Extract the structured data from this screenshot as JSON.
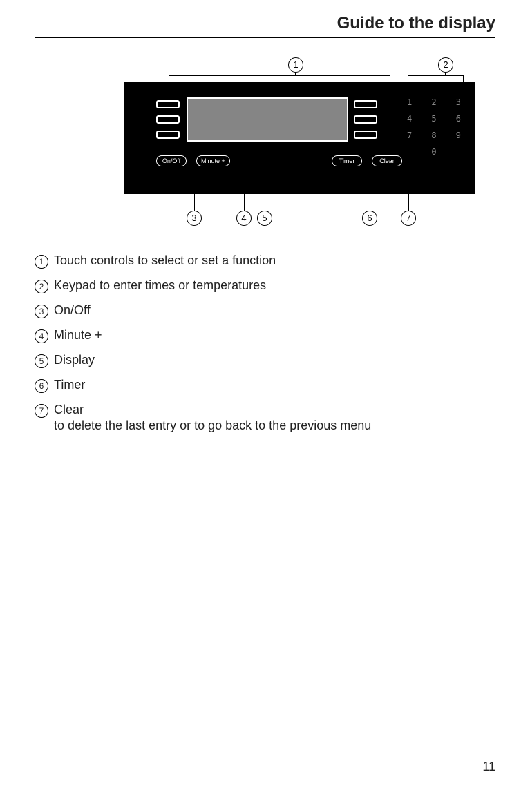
{
  "page": {
    "title": "Guide to the display",
    "number": "11"
  },
  "panel": {
    "buttons": {
      "onoff": "On/Off",
      "minute": "Minute +",
      "timer": "Timer",
      "clear": "Clear"
    },
    "keypad": [
      "1",
      "2",
      "3",
      "4",
      "5",
      "6",
      "7",
      "8",
      "9",
      "0"
    ]
  },
  "callouts": {
    "c1": "1",
    "c2": "2",
    "c3": "3",
    "c4": "4",
    "c5": "5",
    "c6": "6",
    "c7": "7"
  },
  "legend": [
    {
      "num": "1",
      "text": "Touch controls to select or set a function"
    },
    {
      "num": "2",
      "text": "Keypad to enter times or temperatures"
    },
    {
      "num": "3",
      "text": "On/Off"
    },
    {
      "num": "4",
      "text": "Minute +"
    },
    {
      "num": "5",
      "text": "Display"
    },
    {
      "num": "6",
      "text": "Timer"
    },
    {
      "num": "7",
      "text": "Clear",
      "sub": "to delete the last entry or to go back to the previous menu"
    }
  ]
}
